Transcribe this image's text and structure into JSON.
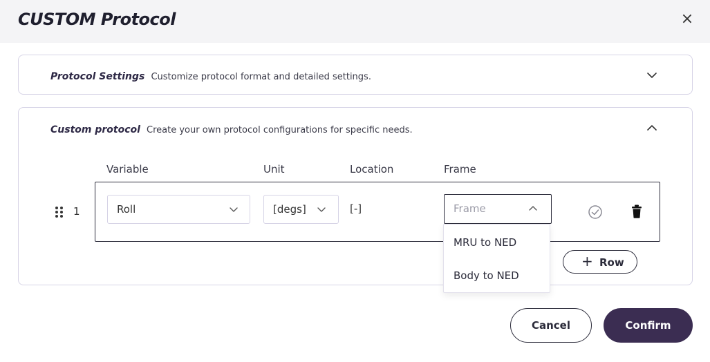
{
  "dialog": {
    "title": "CUSTOM Protocol",
    "close_label": "×"
  },
  "settings_panel": {
    "title": "Protocol Settings",
    "description": "Customize protocol format and detailed settings.",
    "state_icon": "chevron-down-icon"
  },
  "custom_panel": {
    "title": "Custom protocol",
    "description": "Create your own protocol configurations for specific needs.",
    "state_icon": "chevron-up-icon",
    "columns": [
      "Variable",
      "Unit",
      "Location",
      "Frame"
    ],
    "rows": [
      {
        "index": "1",
        "variable": "Roll",
        "unit": "[degs]",
        "location": "[-]",
        "frame_placeholder": "Frame"
      }
    ],
    "add_row": {
      "plus": "+",
      "label": "Row"
    }
  },
  "frame_dropdown": {
    "options": [
      "MRU to NED",
      "Body to NED"
    ]
  },
  "footer": {
    "cancel_label": "Cancel",
    "confirm_label": "Confirm"
  },
  "colors": {
    "header_bg": "#f4f4f6",
    "panel_border": "#d6d3e6",
    "accent": "#3b2d52"
  }
}
